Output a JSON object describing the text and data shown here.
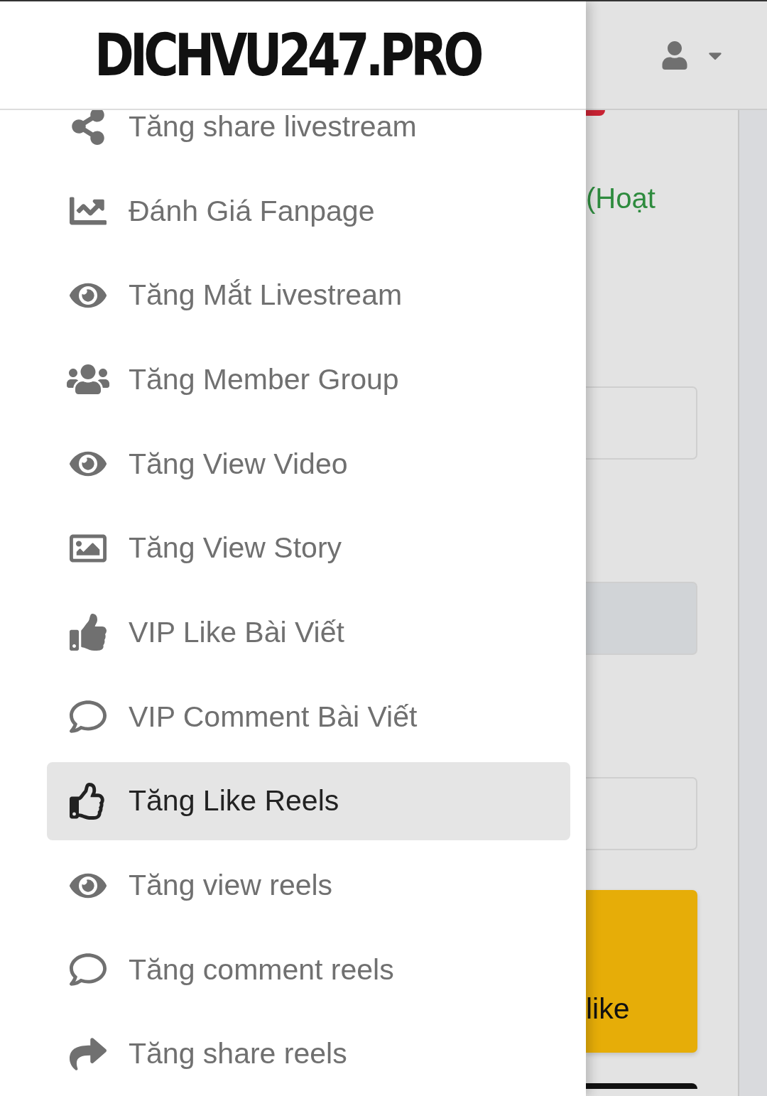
{
  "logo": "DICHVU247.PRO",
  "menu": [
    {
      "label": "Tăng share livestream",
      "selected": false
    },
    {
      "label": "Đánh Giá Fanpage",
      "selected": false
    },
    {
      "label": "Tăng Mắt Livestream",
      "selected": false
    },
    {
      "label": "Tăng Member Group",
      "selected": false
    },
    {
      "label": "Tăng View Video",
      "selected": false
    },
    {
      "label": "Tăng View Story",
      "selected": false
    },
    {
      "label": "VIP Like Bài Viết",
      "selected": false
    },
    {
      "label": "VIP Comment Bài Viết",
      "selected": false
    },
    {
      "label": "Tăng Like Reels",
      "selected": true
    },
    {
      "label": "Tăng view reels",
      "selected": false
    },
    {
      "label": "Tăng comment reels",
      "selected": false
    },
    {
      "label": "Tăng share reels",
      "selected": false
    }
  ],
  "background": {
    "status_text": "(Hoạt",
    "button_text": "like"
  }
}
